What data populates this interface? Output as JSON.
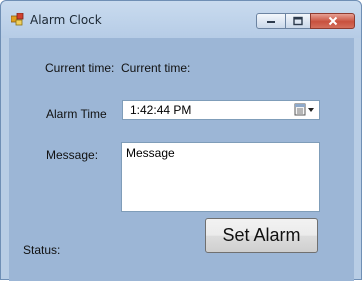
{
  "window": {
    "title": "Alarm Clock"
  },
  "form": {
    "current_time_label": "Current time:",
    "current_time_value": "Current time:",
    "alarm_time_label": "Alarm Time",
    "alarm_time_value": "1:42:44 PM",
    "message_label": "Message:",
    "message_value": "Message",
    "status_label": "Status:",
    "set_alarm_button": "Set Alarm"
  },
  "icons": {
    "app": "alarm-clock-app-icon",
    "minimize": "minimize-icon",
    "maximize": "maximize-icon",
    "close": "close-icon",
    "picker": "calendar-dropdown-icon"
  }
}
